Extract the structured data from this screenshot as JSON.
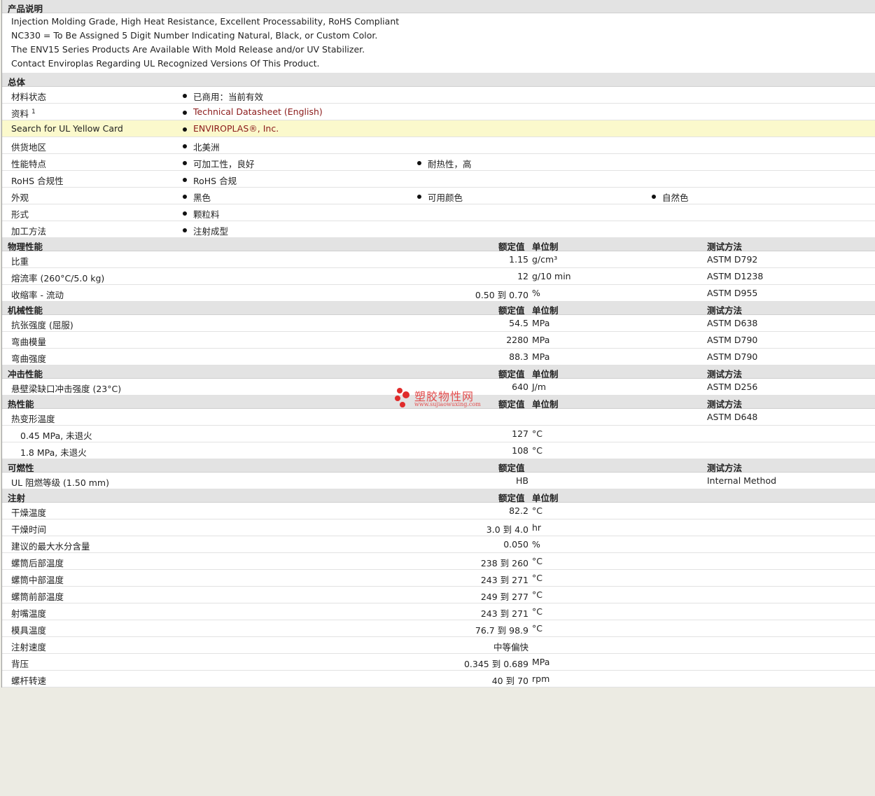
{
  "description": {
    "header": "产品说明",
    "lines": [
      "Injection Molding Grade, High Heat Resistance, Excellent Processability, RoHS Compliant",
      "NC330 = To Be Assigned 5 Digit Number Indicating Natural, Black, or Custom Color.",
      "The ENV15 Series Products Are Available With Mold Release and/or UV Stabilizer.",
      "Contact Enviroplas Regarding UL Recognized Versions Of This Product."
    ]
  },
  "general": {
    "header": "总体",
    "material_status_label": "材料状态",
    "material_status_value": "已商用：当前有效",
    "docs_label": "资料",
    "docs_sup": "1",
    "docs_value": "Technical Datasheet (English)",
    "ul_label": "Search for UL Yellow Card",
    "ul_value": "ENVIROPLAS®, Inc.",
    "region_label": "供货地区",
    "region_value": "北美洲",
    "features_label": "性能特点",
    "features": [
      "可加工性，良好",
      "耐热性，高"
    ],
    "rohs_label": "RoHS 合规性",
    "rohs_value": "RoHS 合规",
    "appearance_label": "外观",
    "appearance": [
      "黑色",
      "可用颜色",
      "自然色"
    ],
    "form_label": "形式",
    "form_value": "颗粒料",
    "process_label": "加工方法",
    "process_value": "注射成型"
  },
  "col_headers": {
    "value": "额定值",
    "unit": "单位制",
    "method": "测试方法"
  },
  "physical": {
    "header": "物理性能",
    "rows": [
      {
        "label": "比重",
        "value": "1.15",
        "unit": "g/cm³",
        "method": "ASTM D792"
      },
      {
        "label": "熔流率  (260°C/5.0 kg)",
        "value": "12",
        "unit": "g/10 min",
        "method": "ASTM D1238"
      },
      {
        "label": "收缩率  - 流动",
        "value": "0.50 到  0.70",
        "unit": "%",
        "method": "ASTM D955"
      }
    ]
  },
  "mechanical": {
    "header": "机械性能",
    "rows": [
      {
        "label": "抗张强度  (屈服)",
        "value": "54.5",
        "unit": "MPa",
        "method": "ASTM D638"
      },
      {
        "label": "弯曲模量",
        "value": "2280",
        "unit": "MPa",
        "method": "ASTM D790"
      },
      {
        "label": "弯曲强度",
        "value": "88.3",
        "unit": "MPa",
        "method": "ASTM D790"
      }
    ]
  },
  "impact": {
    "header": "冲击性能",
    "rows": [
      {
        "label": "悬壁梁缺口冲击强度  (23°C)",
        "value": "640",
        "unit": "J/m",
        "method": "ASTM D256"
      }
    ]
  },
  "thermal": {
    "header": "热性能",
    "hdt_label": "热变形温度",
    "hdt_method": "ASTM D648",
    "rows": [
      {
        "label": "0.45 MPa, 未退火",
        "value": "127",
        "unit": "°C"
      },
      {
        "label": "1.8 MPa, 未退火",
        "value": "108",
        "unit": "°C"
      }
    ]
  },
  "flammability": {
    "header": "可燃性",
    "rows": [
      {
        "label": "UL 阻燃等级  (1.50 mm)",
        "value": "HB",
        "method": "Internal Method"
      }
    ]
  },
  "injection": {
    "header": "注射",
    "rows": [
      {
        "label": "干燥温度",
        "value": "82.2",
        "unit": "°C"
      },
      {
        "label": "干燥时间",
        "value": "3.0 到  4.0",
        "unit": "hr"
      },
      {
        "label": "建议的最大水分含量",
        "value": "0.050",
        "unit": "%"
      },
      {
        "label": "螺筒后部温度",
        "value": "238 到  260",
        "unit": "°C"
      },
      {
        "label": "螺筒中部温度",
        "value": "243 到  271",
        "unit": "°C"
      },
      {
        "label": "螺筒前部温度",
        "value": "249 到  277",
        "unit": "°C"
      },
      {
        "label": "射嘴温度",
        "value": "243 到  271",
        "unit": "°C"
      },
      {
        "label": "模具温度",
        "value": "76.7 到  98.9",
        "unit": "°C"
      },
      {
        "label": "注射速度",
        "value": "中等偏快",
        "unit": ""
      },
      {
        "label": "背压",
        "value": "0.345 到  0.689",
        "unit": "MPa"
      },
      {
        "label": "螺杆转速",
        "value": "40 到  70",
        "unit": "rpm"
      }
    ]
  },
  "watermark": {
    "text": "塑胶物性网",
    "url": "www.sujiaowuxing.com",
    "color": "#e24b4b"
  }
}
